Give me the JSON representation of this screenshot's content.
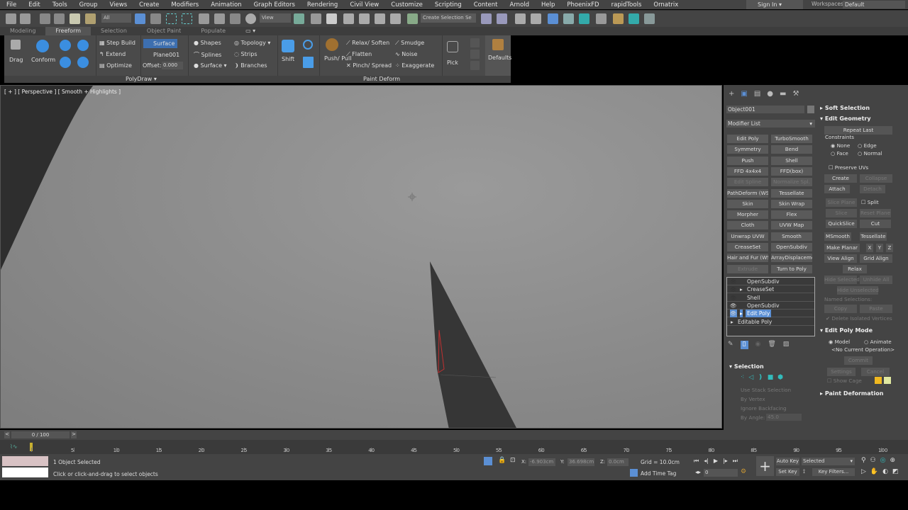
{
  "menu": [
    "File",
    "Edit",
    "Tools",
    "Group",
    "Views",
    "Create",
    "Modifiers",
    "Animation",
    "Graph Editors",
    "Rendering",
    "Civil View",
    "Customize",
    "Scripting",
    "Content",
    "Arnold",
    "Help",
    "PhoenixFD",
    "rapidTools",
    "Ornatrix"
  ],
  "account": {
    "sign_in": "Sign In",
    "workspaces_label": "Workspaces:",
    "workspace": "Default"
  },
  "toolbar": {
    "filter": "All",
    "refcoord": "View",
    "selection_set": "Create Selection Se"
  },
  "ribbon_tabs": [
    {
      "label": "Modeling"
    },
    {
      "label": "Freeform",
      "active": true
    },
    {
      "label": "Selection"
    },
    {
      "label": "Object Paint"
    },
    {
      "label": "Populate"
    }
  ],
  "ribbon": {
    "drag": "Drag",
    "conform": "Conform",
    "step_build": "Step Build",
    "extend": "Extend",
    "optimize": "Optimize",
    "surface_btn": "Surface",
    "plane": "Plane001",
    "offset_label": "Offset:",
    "offset_value": "0.000",
    "shapes": "Shapes",
    "splines": "Splines",
    "surface": "Surface",
    "topology": "Topology",
    "strips": "Strips",
    "branches": "Branches",
    "shift": "Shift",
    "push_pull": "Push/ Pull",
    "relax_soften": "Relax/ Soften",
    "flatten": "Flatten",
    "pinch_spread": "Pinch/ Spread",
    "smudge": "Smudge",
    "noise": "Noise",
    "exaggerate": "Exaggerate",
    "pick": "Pick",
    "defaults": "Defaults",
    "polydraw_group": "PolyDraw ▾",
    "paint_deform_group": "Paint Deform"
  },
  "viewport": {
    "label": "[ + ] [ Perspective ] [ Smooth + Highlights ]"
  },
  "command_panel": {
    "object_name": "Object001",
    "modifier_list": "Modifier List",
    "modifiers": [
      {
        "l": "Edit Poly"
      },
      {
        "l": "TurboSmooth"
      },
      {
        "l": "Symmetry"
      },
      {
        "l": "Bend"
      },
      {
        "l": "Push"
      },
      {
        "l": "Shell"
      },
      {
        "l": "FFD 4x4x4"
      },
      {
        "l": "FFD(box)"
      },
      {
        "l": "Edit Spline",
        "d": true
      },
      {
        "l": "Normalize Spl.",
        "d": true
      },
      {
        "l": "PathDeform (WSM)"
      },
      {
        "l": "Tessellate"
      },
      {
        "l": "Skin"
      },
      {
        "l": "Skin Wrap"
      },
      {
        "l": "Morpher"
      },
      {
        "l": "Flex"
      },
      {
        "l": "Cloth"
      },
      {
        "l": "UVW Map"
      },
      {
        "l": "Unwrap UVW"
      },
      {
        "l": "Smooth"
      },
      {
        "l": "CreaseSet"
      },
      {
        "l": "OpenSubdiv"
      },
      {
        "l": "Hair and Fur (WSM)"
      },
      {
        "l": "ArrayDisplacementMod"
      },
      {
        "l": "Extrude",
        "d": true
      },
      {
        "l": "Turn to Poly"
      }
    ],
    "stack": [
      {
        "l": "OpenSubdiv",
        "eye": false,
        "arrow": false
      },
      {
        "l": "CreaseSet",
        "eye": false,
        "arrow": true
      },
      {
        "l": "Shell",
        "eye": false,
        "arrow": false
      },
      {
        "l": "OpenSubdiv",
        "eye": true,
        "arrow": false
      },
      {
        "l": "Edit Poly",
        "eye": true,
        "arrow": true,
        "sel": true
      },
      {
        "l": "Editable Poly",
        "base": true
      }
    ],
    "selection": {
      "title": "Selection",
      "use_stack": "Use Stack Selection",
      "by_vertex": "By Vertex",
      "ignore_backfacing": "Ignore Backfacing",
      "by_angle": "By Angle:",
      "angle": "45.0"
    },
    "soft_selection": "Soft Selection",
    "edit_geometry": {
      "title": "Edit Geometry",
      "repeat_last": "Repeat Last",
      "constraints": "Constraints",
      "none": "None",
      "edge": "Edge",
      "face": "Face",
      "normal": "Normal",
      "preserve_uvs": "Preserve UVs",
      "create": "Create",
      "collapse": "Collapse",
      "attach": "Attach",
      "detach": "Detach",
      "slice_plane": "Slice Plane",
      "split": "Split",
      "slice": "Slice",
      "reset_plane": "Reset Plane",
      "quickslice": "QuickSlice",
      "cut": "Cut",
      "msmooth": "MSmooth",
      "tessellate": "Tessellate",
      "make_planar": "Make Planar",
      "x": "X",
      "y": "Y",
      "z": "Z",
      "view_align": "View Align",
      "grid_align": "Grid Align",
      "relax": "Relax",
      "hide_selected": "Hide Selected",
      "unhide_all": "Unhide All",
      "hide_unselected": "Hide Unselected",
      "named_selections": "Named Selections:",
      "copy": "Copy",
      "paste": "Paste",
      "delete_isolated": "Delete Isolated Vertices"
    },
    "edit_poly_mode": {
      "title": "Edit Poly Mode",
      "model": "Model",
      "animate": "Animate",
      "operation": "<No Current Operation>",
      "commit": "Commit",
      "settings": "Settings",
      "cancel": "Cancel",
      "show_cage": "Show Cage",
      "cage_colors": [
        "#f0b820",
        "#e0e8a0"
      ]
    },
    "paint_deformation": "Paint Deformation"
  },
  "timeline": {
    "frame": "0 / 100",
    "current": 0,
    "ticks": [
      0,
      5,
      10,
      15,
      20,
      25,
      30,
      35,
      40,
      45,
      50,
      55,
      60,
      65,
      70,
      75,
      80,
      85,
      90,
      95,
      100
    ]
  },
  "status": {
    "selected": "1 Object Selected",
    "prompt": "Click or click-and-drag to select objects",
    "x_label": "X:",
    "x": "-6.903cm",
    "y_label": "Y:",
    "y": "36.698cm",
    "z_label": "Z:",
    "z": "0.0cm",
    "grid": "Grid = 10.0cm",
    "add_time_tag": "Add Time Tag",
    "auto_key": "Auto Key",
    "set_key": "Set Key",
    "key_mode": "Selected",
    "key_filters": "Key Filters...",
    "frame": "0"
  },
  "colors": {
    "accent": "#5b8fd4",
    "viewport": "#8d8d8d",
    "panel": "#444444"
  }
}
